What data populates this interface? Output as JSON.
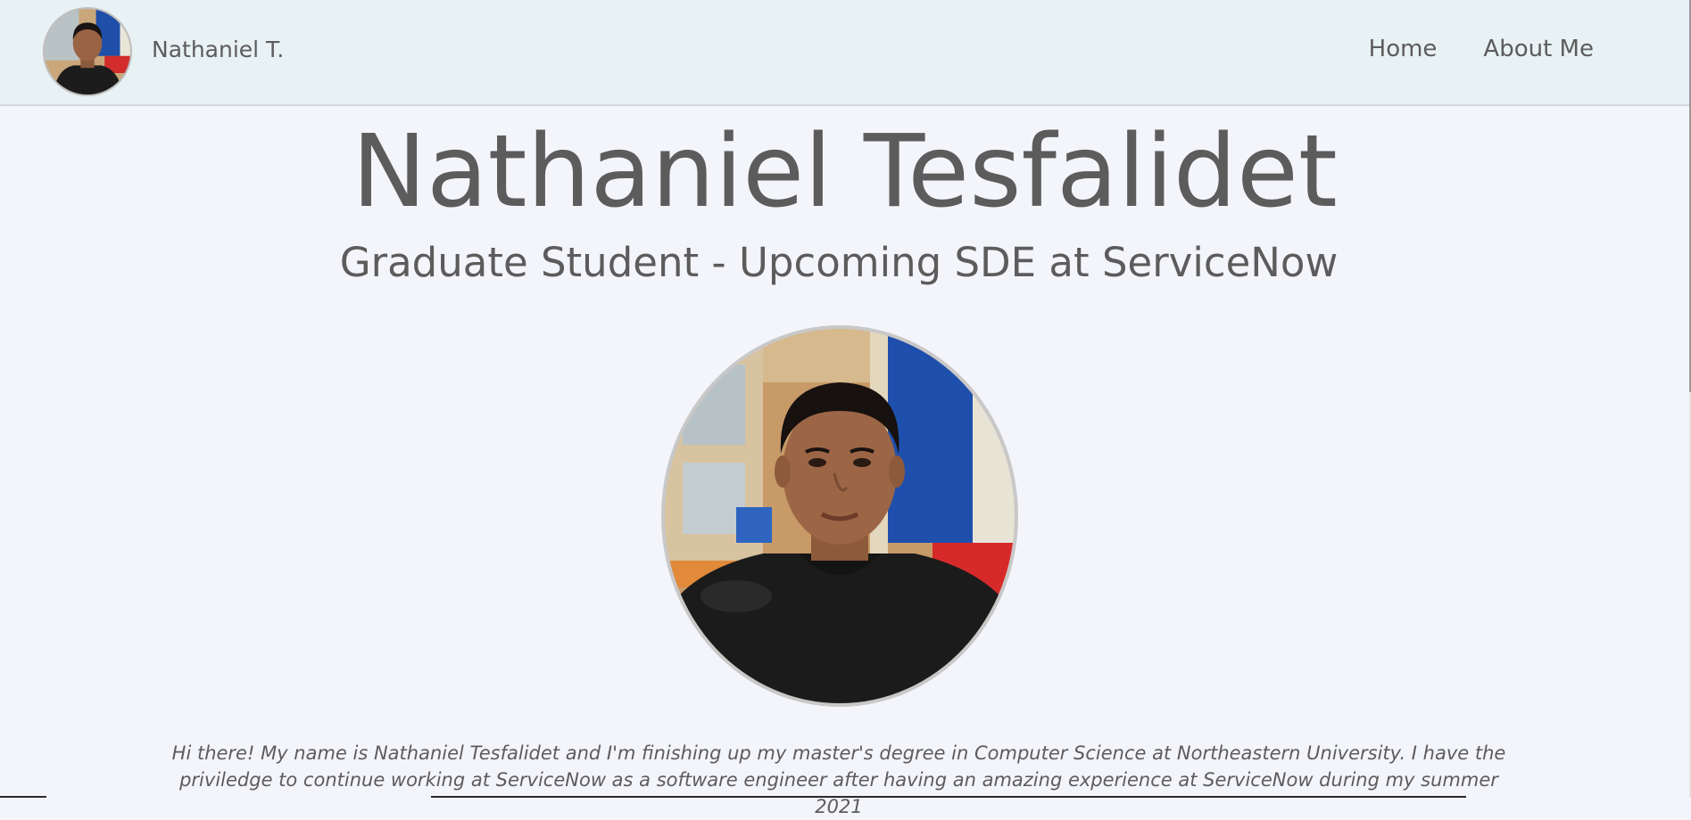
{
  "navbar": {
    "brand_name": "Nathaniel T.",
    "links": [
      {
        "label": "Home"
      },
      {
        "label": "About Me"
      }
    ]
  },
  "hero": {
    "title": "Nathaniel Tesfalidet",
    "subtitle": "Graduate Student - Upcoming SDE at ServiceNow"
  },
  "bio": {
    "text": "Hi there! My name is Nathaniel Tesfalidet and I'm finishing up my master's degree in Computer Science at Northeastern University. I have the priviledge to continue working at ServiceNow as a software engineer after having an amazing experience at ServiceNow during my summer 2021"
  },
  "colors": {
    "navbar_bg": "#e8f1f4",
    "page_bg": "#f4f5fb",
    "text": "#5c5c5c"
  }
}
